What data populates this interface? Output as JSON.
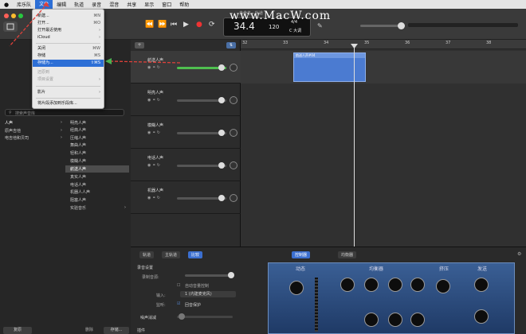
{
  "menubar": {
    "items": [
      "库乐队",
      "文件",
      "编辑",
      "轨道",
      "录音",
      "混音",
      "共享",
      "显示",
      "窗口",
      "帮助"
    ],
    "active_index": 1
  },
  "watermark": "www.MacW.com",
  "title": "未命名 - 轨道",
  "lcd": {
    "position": "34.4",
    "tempo": "120",
    "signature": "4/4",
    "key": "C 大调"
  },
  "file_menu": {
    "items": [
      {
        "label": "新建...",
        "shortcut": "⌘N"
      },
      {
        "label": "打开...",
        "shortcut": "⌘O"
      },
      {
        "label": "打开最近使用",
        "shortcut": "›"
      },
      {
        "label": "iCloud",
        "shortcut": "›"
      },
      {
        "label": "关闭",
        "shortcut": "⌘W"
      },
      {
        "label": "存储",
        "shortcut": "⌘S"
      },
      {
        "label": "存储为...",
        "shortcut": "⇧⌘S"
      },
      {
        "label": "还原到",
        "shortcut": ""
      },
      {
        "label": "项目设置",
        "shortcut": "›"
      },
      {
        "label": "影片",
        "shortcut": "›"
      },
      {
        "label": "将片段添加到乐段库...",
        "shortcut": ""
      }
    ],
    "highlighted_index": 6
  },
  "library": {
    "search_placeholder": "搜索声音库",
    "categories": [
      "人声",
      "原声吉他",
      "电吉他和贝司"
    ],
    "patches": [
      "明亮人声",
      "经典人声",
      "压缩人声",
      "舞曲人声",
      "轻和人声",
      "模糊人声",
      "航送人声",
      "真实人声",
      "电话人声",
      "机器人人声",
      "阻塞人声",
      "实验音乐"
    ],
    "selected_patch_index": 6,
    "footer": {
      "revert": "复原",
      "delete": "删除",
      "save": "存储..."
    }
  },
  "tracks": [
    {
      "name": "航送人声"
    },
    {
      "name": "明亮人声"
    },
    {
      "name": "模糊人声"
    },
    {
      "name": "电话人声"
    },
    {
      "name": "机器人声"
    }
  ],
  "ruler": [
    "32",
    "33",
    "34",
    "35",
    "36",
    "37",
    "38"
  ],
  "region": {
    "label": "航送人声#04"
  },
  "bottom_tabs": {
    "track": "轨道",
    "master": "主轨道",
    "compare": "比较",
    "controls": "控制器",
    "eq": "均衡器"
  },
  "smart_controls": {
    "section": "录音设置",
    "monitor": "录制音源:",
    "auto_gain": "自动音量控制",
    "input_label": "输入:",
    "input_value": "1 (内建麦克风)",
    "feedback_label": "监听:",
    "feedback_value": "回音保护",
    "noise_gate": "噪声消减",
    "plugins": "插件"
  },
  "plugin": {
    "sections": [
      "动态",
      "均衡器",
      "挤压",
      "发送"
    ]
  }
}
